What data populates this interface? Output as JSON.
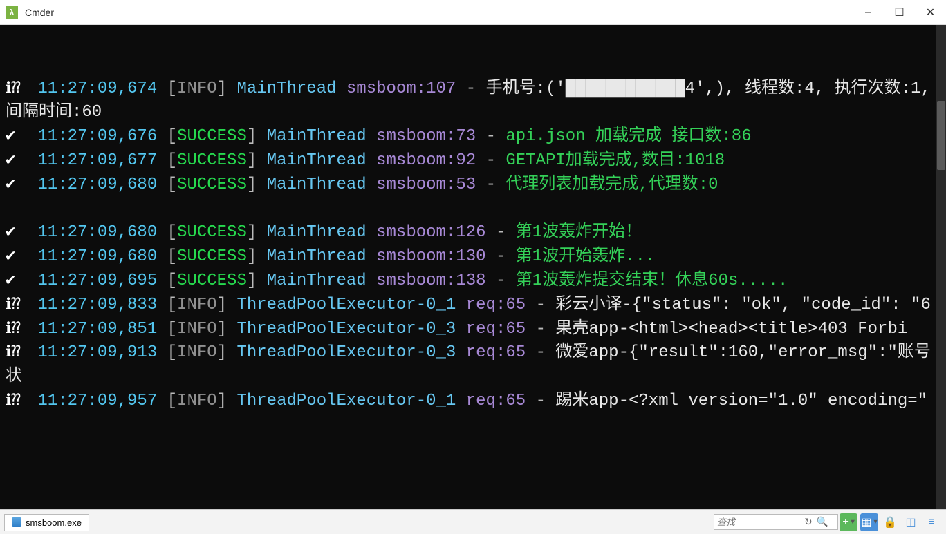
{
  "window": {
    "title": "Cmder",
    "icon_glyph": "λ"
  },
  "controls": {
    "minimize": "–",
    "maximize": "☐",
    "close": "✕"
  },
  "log_lines": [
    {
      "icon": "info",
      "ts": "11:27:09,674",
      "lvl": "INFO",
      "thread": "MainThread",
      "src": "smsboom:107",
      "msg": "手机号:('████████████4',), 线程数:4, 执行次数:1, 间隔时间:60",
      "msg_class": "msg"
    },
    {
      "icon": "check",
      "ts": "11:27:09,676",
      "lvl": "SUCCESS",
      "thread": "MainThread",
      "src": "smsboom:73",
      "msg": "api.json 加载完成 接口数:86",
      "msg_class": "msg-green"
    },
    {
      "icon": "check",
      "ts": "11:27:09,677",
      "lvl": "SUCCESS",
      "thread": "MainThread",
      "src": "smsboom:92",
      "msg": "GETAPI加载完成,数目:1018",
      "msg_class": "msg-green"
    },
    {
      "icon": "check",
      "ts": "11:27:09,680",
      "lvl": "SUCCESS",
      "thread": "MainThread",
      "src": "smsboom:53",
      "msg": "代理列表加载完成,代理数:0",
      "msg_class": "msg-green"
    },
    {
      "blank": true
    },
    {
      "icon": "check",
      "ts": "11:27:09,680",
      "lvl": "SUCCESS",
      "thread": "MainThread",
      "src": "smsboom:126",
      "msg": "第1波轰炸开始！",
      "msg_class": "msg-green"
    },
    {
      "icon": "check",
      "ts": "11:27:09,680",
      "lvl": "SUCCESS",
      "thread": "MainThread",
      "src": "smsboom:130",
      "msg": "第1波开始轰炸...",
      "msg_class": "msg-green"
    },
    {
      "icon": "check",
      "ts": "11:27:09,695",
      "lvl": "SUCCESS",
      "thread": "MainThread",
      "src": "smsboom:138",
      "msg": "第1波轰炸提交结束！休息60s.....",
      "msg_class": "msg-green"
    },
    {
      "icon": "info",
      "ts": "11:27:09,833",
      "lvl": "INFO",
      "thread": "ThreadPoolExecutor-0_1",
      "src": "req:65",
      "msg": "彩云小译-{\"status\": \"ok\", \"code_id\": \"6",
      "msg_class": "msg"
    },
    {
      "icon": "info",
      "ts": "11:27:09,851",
      "lvl": "INFO",
      "thread": "ThreadPoolExecutor-0_3",
      "src": "req:65",
      "msg": "果壳app-<html><head><title>403 Forbi",
      "msg_class": "msg"
    },
    {
      "icon": "info",
      "ts": "11:27:09,913",
      "lvl": "INFO",
      "thread": "ThreadPoolExecutor-0_3",
      "src": "req:65",
      "msg": "微爱app-{\"result\":160,\"error_msg\":\"账号状",
      "msg_class": "msg"
    },
    {
      "icon": "info",
      "ts": "11:27:09,957",
      "lvl": "INFO",
      "thread": "ThreadPoolExecutor-0_1",
      "src": "req:65",
      "msg": "踢米app-<?xml version=\"1.0\" encoding=\"",
      "msg_class": "msg"
    }
  ],
  "statusbar": {
    "tab_name": "smsboom.exe",
    "search_placeholder": "查找"
  },
  "toolbar": {
    "plus": "+",
    "grid": "▦",
    "lock": "🔒",
    "split": "◫",
    "menu": "≡"
  }
}
